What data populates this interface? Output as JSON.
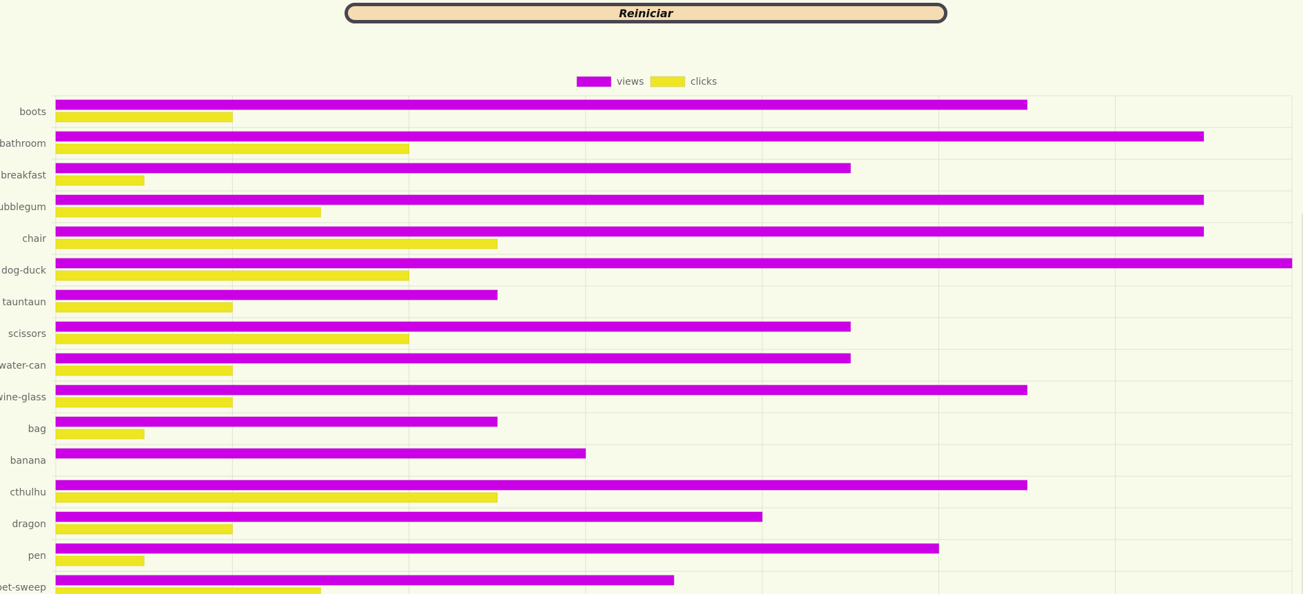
{
  "reset_button": {
    "label": "Reiniciar"
  },
  "colors": {
    "views": "#cc00e6",
    "clicks": "#eee622",
    "background": "#f9fbea",
    "grid": "#dfe0d5"
  },
  "chart_data": {
    "type": "bar",
    "orientation": "horizontal",
    "categories": [
      "boots",
      "bathroom",
      "breakfast",
      "bubblegum",
      "chair",
      "dog-duck",
      "tauntaun",
      "scissors",
      "water-can",
      "wine-glass",
      "bag",
      "banana",
      "cthulhu",
      "dragon",
      "pen",
      "pet-sweep"
    ],
    "series": [
      {
        "name": "views",
        "values": [
          11,
          13,
          9,
          13,
          13,
          14,
          5,
          9,
          9,
          11,
          5,
          6,
          11,
          8,
          10,
          7
        ]
      },
      {
        "name": "clicks",
        "values": [
          2,
          4,
          1,
          3,
          5,
          4,
          2,
          4,
          2,
          2,
          1,
          0,
          5,
          2,
          1,
          3
        ]
      }
    ],
    "xlim": [
      0,
      14
    ],
    "grid": true,
    "legend": "top-center"
  }
}
